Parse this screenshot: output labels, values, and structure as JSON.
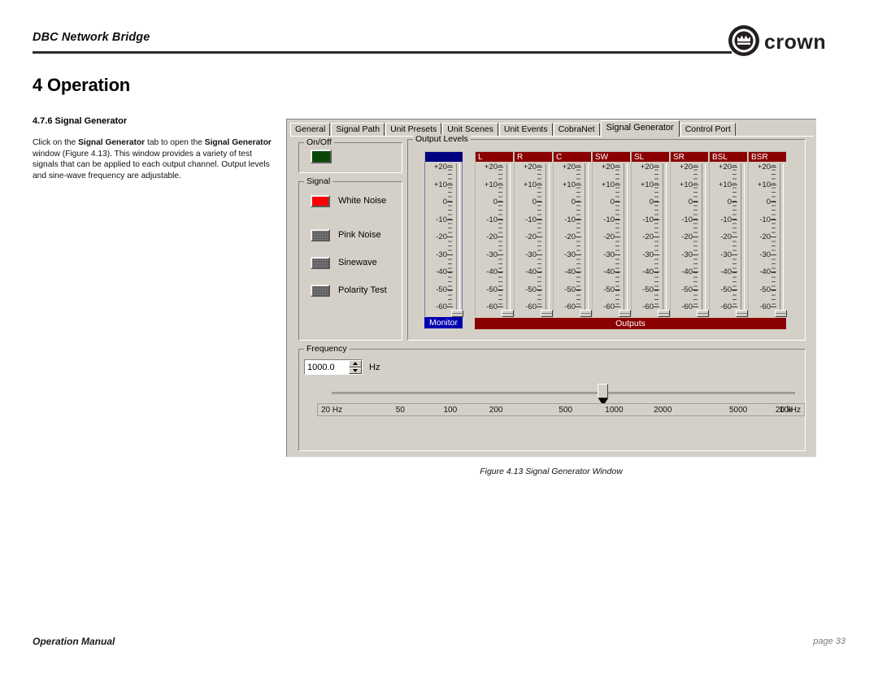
{
  "page": {
    "running_head": "DBC Network Bridge",
    "chapter_title": "4 Operation",
    "section_heading": "4.7.6 Signal Generator",
    "body_paragraph_html": "Click on the <b>Signal Generator</b> tab to open the <b>Signal Generator</b> window (Figure 4.13). This window provides a variety of test signals that can be applied to each output channel. Output levels and sine-wave frequency are adjustable.",
    "figure_caption": "Figure 4.13  Signal Generator Window",
    "footer_left": "Operation Manual",
    "footer_right": "page 33",
    "logo_wordmark": "crown"
  },
  "window": {
    "tabs": [
      {
        "label": "General",
        "active": false
      },
      {
        "label": "Signal Path",
        "active": false
      },
      {
        "label": "Unit Presets",
        "active": false
      },
      {
        "label": "Unit Scenes",
        "active": false
      },
      {
        "label": "Unit Events",
        "active": false
      },
      {
        "label": "CobraNet",
        "active": false
      },
      {
        "label": "Signal Generator",
        "active": true
      },
      {
        "label": "Control Port",
        "active": false
      }
    ],
    "onoff": {
      "group_label": "On/Off",
      "state": "on",
      "color": "#0a5c0a"
    },
    "signal": {
      "group_label": "Signal",
      "selected": "White Noise",
      "active_color": "#fb0000",
      "inactive_color": "#4a4a4a",
      "options": [
        {
          "label": "White Noise",
          "selected": true
        },
        {
          "label": "Pink Noise",
          "selected": false
        },
        {
          "label": "Sinewave",
          "selected": false
        },
        {
          "label": "Polarity Test",
          "selected": false
        }
      ]
    },
    "output_levels": {
      "group_label": "Output Levels",
      "monitor_header_color": "#000080",
      "output_header_color": "#8b0000",
      "scale_labels": [
        "+20",
        "+10",
        "0",
        "-10",
        "-20",
        "-30",
        "-40",
        "-50",
        "-60"
      ],
      "monitor": {
        "header": "",
        "footer": "Monitor",
        "slider_position": "bottom"
      },
      "outputs_footer": "Outputs",
      "channels": [
        {
          "label": "L",
          "slider_position": "bottom"
        },
        {
          "label": "R",
          "slider_position": "bottom"
        },
        {
          "label": "C",
          "slider_position": "bottom"
        },
        {
          "label": "SW",
          "slider_position": "bottom"
        },
        {
          "label": "SL",
          "slider_position": "bottom"
        },
        {
          "label": "SR",
          "slider_position": "bottom"
        },
        {
          "label": "BSL",
          "slider_position": "bottom"
        },
        {
          "label": "BSR",
          "slider_position": "bottom"
        }
      ]
    },
    "frequency": {
      "group_label": "Frequency",
      "value": "1000.0",
      "unit": "Hz",
      "slider_value": "1000",
      "scale_labels": [
        "20 Hz",
        "50",
        "100",
        "200",
        "500",
        "1000",
        "2000",
        "5000",
        "10k",
        "20 kHz"
      ]
    }
  }
}
